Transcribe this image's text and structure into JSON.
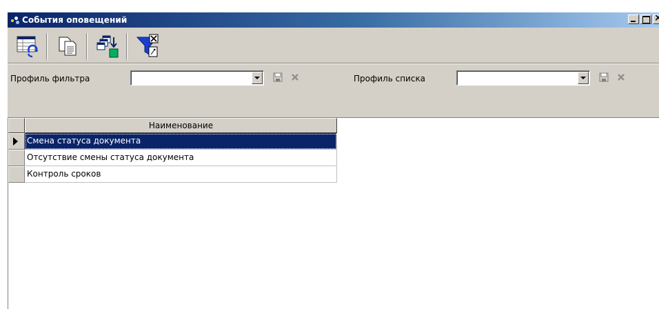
{
  "window": {
    "title": "События оповещений",
    "icon": "bell-icon",
    "controls": [
      "minimize-icon",
      "maximize-icon",
      "close-icon"
    ]
  },
  "toolbar": {
    "buttons": [
      {
        "icon": "table-refresh-icon"
      },
      {
        "icon": "copy-documents-icon"
      },
      {
        "icon": "windows-import-icon"
      },
      {
        "icon": "filter-clear-icon"
      }
    ]
  },
  "filter": {
    "filter_profile_label": "Профиль фильтра",
    "filter_profile_value": "",
    "list_profile_label": "Профиль списка",
    "list_profile_value": ""
  },
  "grid": {
    "column_header": "Наименование",
    "rows": [
      {
        "name": "Смена статуса документа",
        "selected": true
      },
      {
        "name": "Отсутствие смены статуса документа",
        "selected": false
      },
      {
        "name": "Контроль сроков",
        "selected": false
      }
    ]
  },
  "colors": {
    "title_start": "#0a246a",
    "title_end": "#a6caf0",
    "selection": "#0a246a",
    "face": "#d4d0c8"
  }
}
